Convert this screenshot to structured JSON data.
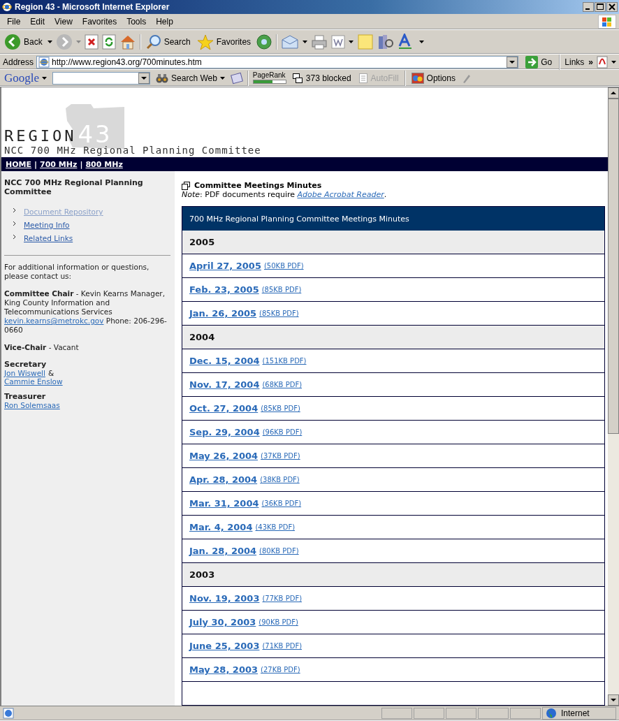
{
  "window": {
    "title": "Region 43 - Microsoft Internet Explorer"
  },
  "menu": [
    "File",
    "Edit",
    "View",
    "Favorites",
    "Tools",
    "Help"
  ],
  "toolbar": {
    "back": "Back",
    "search": "Search",
    "favorites": "Favorites"
  },
  "address_bar": {
    "label": "Address",
    "url": "http://www.region43.org/700minutes.htm",
    "go": "Go",
    "links": "Links",
    "chevron": "»"
  },
  "google_bar": {
    "logo": "Google",
    "search_web": "Search Web",
    "pagerank": {
      "label": "PageRank",
      "level": 0.6
    },
    "blocked": "373 blocked",
    "autofill": "AutoFill",
    "autofill_disabled": true,
    "options": "Options"
  },
  "site": {
    "logo_word": "REGION",
    "logo_number": "43",
    "subtitle": "NCC 700 MHz Regional Planning Committee",
    "nav": [
      "HOME",
      "700 MHz",
      "800 MHz"
    ],
    "nav_separator": "|"
  },
  "sidebar": {
    "title": "NCC 700 MHz Regional Planning Committee",
    "items": [
      {
        "label": "Document Repository",
        "visited": true
      },
      {
        "label": "Meeting Info",
        "visited": false
      },
      {
        "label": "Related Links",
        "visited": false
      }
    ],
    "intro": "For additional information or questions, please contact us:",
    "chair": {
      "text": "**Committee Chair** - Kevin Kearns Manager, King County Information and Telecommunications Services",
      "email": "kevin.kearns@metrokc.gov",
      "after": "Phone: 206-296-0660"
    },
    "vice_chair": "**Vice-Chair** - Vacant",
    "secretary": {
      "heading": "Secretary",
      "names": [
        "Jon Wiswell",
        "Cammie Enslow"
      ],
      "joiner": "&"
    },
    "treasurer": {
      "heading": "Treasurer",
      "names": [
        "Ron Solemsaas"
      ]
    }
  },
  "main": {
    "title": "Committee Meetings Minutes",
    "note_label": "Note",
    "note_text": ": PDF documents require",
    "note_link": "Adobe Acrobat Reader",
    "note_end": ".",
    "table": {
      "caption": "700 MHz Regional Planning Committee Meetings Minutes",
      "rows": [
        {
          "kind": "year",
          "label": "2005"
        },
        {
          "kind": "entry",
          "date": "April 27, 2005",
          "size": "(50KB PDF)"
        },
        {
          "kind": "entry",
          "date": "Feb. 23, 2005",
          "size": "(85KB PDF)"
        },
        {
          "kind": "entry",
          "date": "Jan. 26, 2005",
          "size": "(85KB PDF)"
        },
        {
          "kind": "year",
          "label": "2004"
        },
        {
          "kind": "entry",
          "date": "Dec. 15, 2004",
          "size": "(151KB PDF)"
        },
        {
          "kind": "entry",
          "date": "Nov. 17, 2004",
          "size": "(68KB PDF)"
        },
        {
          "kind": "entry",
          "date": "Oct. 27, 2004",
          "size": "(85KB PDF)"
        },
        {
          "kind": "entry",
          "date": "Sep. 29, 2004",
          "size": "(96KB PDF)"
        },
        {
          "kind": "entry",
          "date": "May 26, 2004",
          "size": "(37KB PDF)"
        },
        {
          "kind": "entry",
          "date": "Apr. 28, 2004",
          "size": "(38KB PDF)"
        },
        {
          "kind": "entry",
          "date": "Mar. 31, 2004",
          "size": "(36KB PDF)"
        },
        {
          "kind": "entry",
          "date": "Mar. 4, 2004",
          "size": "(43KB PDF)"
        },
        {
          "kind": "entry",
          "date": "Jan. 28, 2004",
          "size": "(80KB PDF)"
        },
        {
          "kind": "year",
          "label": "2003"
        },
        {
          "kind": "entry",
          "date": "Nov. 19, 2003",
          "size": "(77KB PDF)"
        },
        {
          "kind": "entry",
          "date": "July 30, 2003",
          "size": "(90KB PDF)"
        },
        {
          "kind": "entry",
          "date": "June 25, 2003",
          "size": "(71KB PDF)"
        },
        {
          "kind": "entry",
          "date": "May 28, 2003",
          "size": "(27KB PDF)"
        }
      ]
    }
  },
  "status_bar": {
    "zone": "Internet"
  }
}
